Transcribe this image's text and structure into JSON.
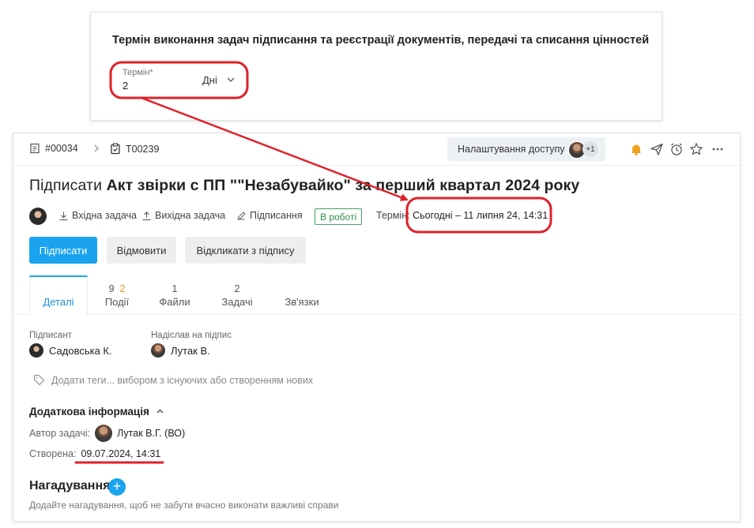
{
  "settings": {
    "title": "Термін виконання задач підписання та реєстрації документів, передачі та списання цінностей",
    "term_label": "Термін*",
    "term_value": "2",
    "term_unit": "Дні"
  },
  "breadcrumb": {
    "parent_id": "#00034",
    "task_id": "T00239"
  },
  "header": {
    "access_label": "Налаштування доступу",
    "access_extra": "+1"
  },
  "task": {
    "title_prefix": "Підписати ",
    "title_main": "Акт звірки с ПП \"\"Незабувайко\" за перший квартал 2024 року",
    "incoming": "Вхідна задача",
    "outgoing": "Вихідна задача",
    "type": "Підписання",
    "status": "В роботі",
    "status_color": "#3da35d",
    "deadline_label": "Термін:",
    "deadline_value": "Сьогодні – 11 липня 24, 14:31"
  },
  "actions": {
    "sign": "Підписати",
    "reject": "Відмовити",
    "withdraw": "Відкликати з підпису"
  },
  "tabs": [
    {
      "label": "Деталі",
      "count": ""
    },
    {
      "label": "Події",
      "count": "9",
      "count_extra": "2"
    },
    {
      "label": "Файли",
      "count": "1"
    },
    {
      "label": "Задачі",
      "count": "2"
    },
    {
      "label": "Зв'язки",
      "count": ""
    }
  ],
  "details": {
    "signer_label": "Підписант",
    "signer_name": "Садовська К.",
    "sender_label": "Надіслав на підпис",
    "sender_name": "Лутак В.",
    "tags_placeholder": "Додати теги... вибором з існуючих або створенням нових",
    "extra_title": "Додаткова інформація",
    "author_label": "Автор задачі:",
    "author_name": "Лутак В.Г. (ВО)",
    "created_label": "Створена:",
    "created_value": "09.07.2024, 14:31"
  },
  "reminders": {
    "title": "Нагадування",
    "hint": "Додайте нагадування, щоб не забути вчасно виконати важливі справи"
  },
  "accent_color": "#1aa3ef",
  "annotation_color": "#e0202a"
}
